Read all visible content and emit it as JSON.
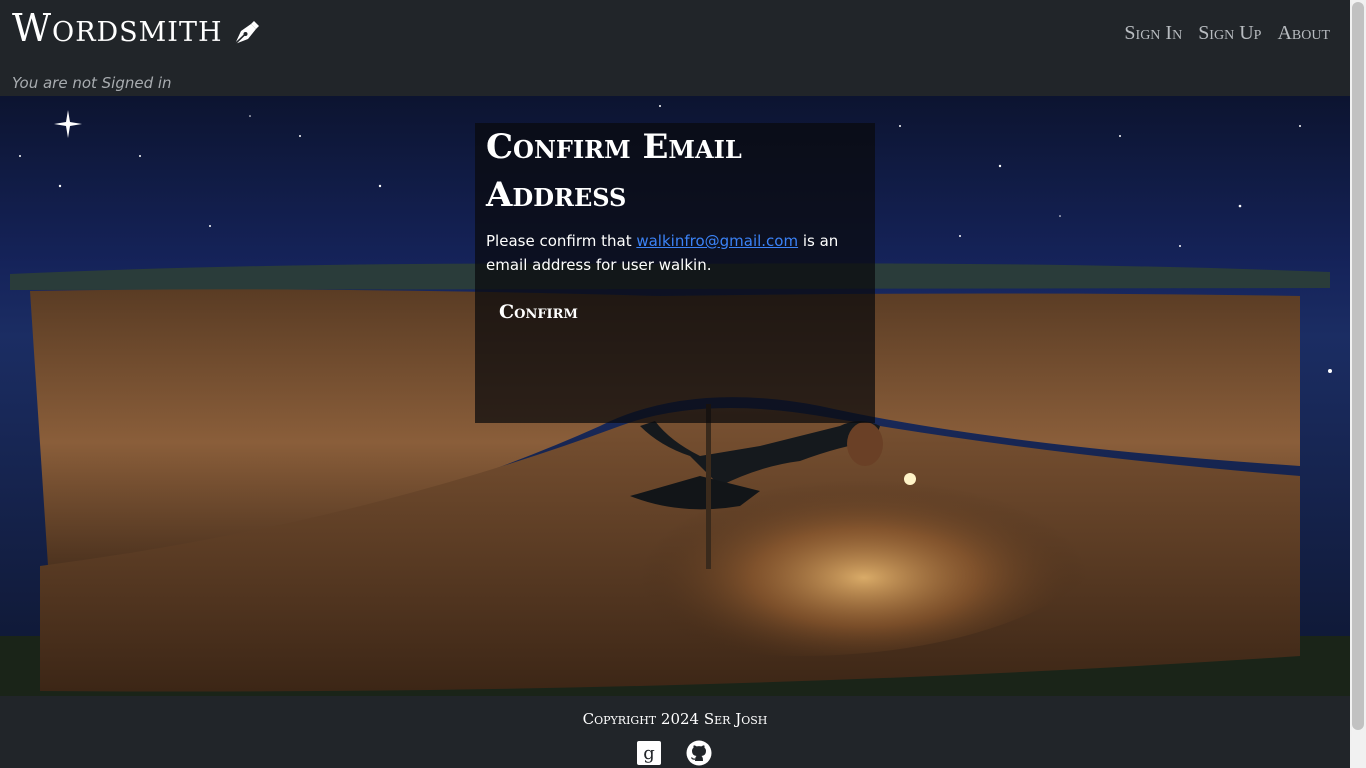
{
  "header": {
    "brand": "Wordsmith",
    "brand_icon": "pen-nib-icon",
    "nav": {
      "sign_in": "Sign In",
      "sign_up": "Sign Up",
      "about": "About"
    },
    "status": "You are not Signed in"
  },
  "main": {
    "title": "Confirm Email Address",
    "text_before": "Please confirm that ",
    "email": "walkinfro@gmail.com",
    "text_after": " is an email address for user walkin.",
    "confirm_button": "Confirm"
  },
  "footer": {
    "copyright": "Copyright 2024 Ser Josh",
    "social": [
      {
        "icon": "goodreads-icon"
      },
      {
        "icon": "github-icon"
      }
    ]
  },
  "colors": {
    "header_bg": "#212529",
    "link": "#3b82f6",
    "nav_text": "#b8bcc0"
  }
}
